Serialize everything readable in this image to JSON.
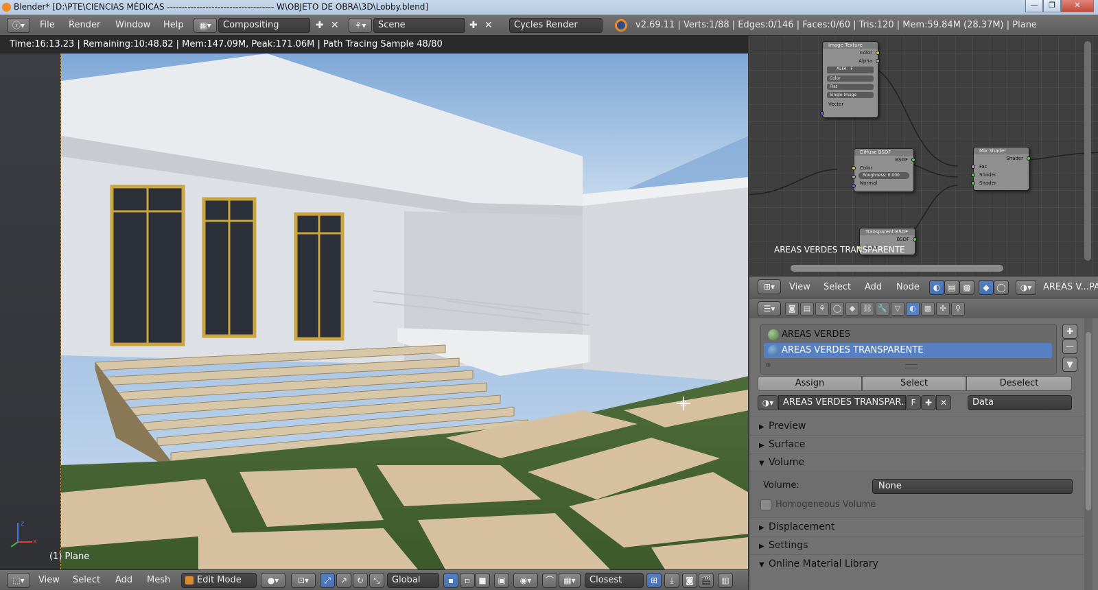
{
  "window": {
    "title": "Blender* [D:\\PTE\\CIENCIAS MÉDICAS ------------------------------------ W\\OBJETO DE OBRA\\3D\\Lobby.blend]",
    "min": "—",
    "max": "❐",
    "close": "✕"
  },
  "topbar": {
    "menus": [
      "File",
      "Render",
      "Window",
      "Help"
    ],
    "screen_layout": "Compositing",
    "scene": "Scene",
    "render_engine": "Cycles Render",
    "stats": "v2.69.11 | Verts:1/88 | Edges:0/146 | Faces:0/60 | Tris:120 | Mem:59.84M (28.37M) | Plane"
  },
  "viewport": {
    "render_info": "Time:16:13.23 | Remaining:10:48.82 | Mem:147.09M, Peak:171.06M | Path Tracing Sample 48/80",
    "object_label": "(1) Plane",
    "axis_x": "x",
    "axis_z": "z"
  },
  "viewport_header": {
    "menus": [
      "View",
      "Select",
      "Add",
      "Mesh"
    ],
    "mode": "Edit Mode",
    "orientation": "Global",
    "snap": "Closest"
  },
  "node_editor": {
    "nodes": {
      "image_texture": {
        "title": "Image Texture",
        "out1": "Color",
        "out2": "Alpha",
        "chip": "ALFA",
        "chip2": "F",
        "opt1": "Color",
        "opt2": "Flat",
        "opt3": "Single Image",
        "in1": "Vector"
      },
      "diffuse": {
        "title": "Diffuse BSDF",
        "out1": "BSDF",
        "in1": "Color",
        "roughness": "Roughness:  0.000",
        "in2": "Normal"
      },
      "mix": {
        "title": "Mix Shader",
        "out1": "Shader",
        "in1": "Fac",
        "in2": "Shader",
        "in3": "Shader"
      },
      "transparent": {
        "title": "Transparent BSDF",
        "out1": "BSDF",
        "in1": "Color"
      }
    },
    "material_label": "AREAS VERDES TRANSPARENTE"
  },
  "node_header": {
    "menus": [
      "View",
      "Select",
      "Add",
      "Node"
    ],
    "material": "AREAS V...PA"
  },
  "properties": {
    "slots": [
      "AREAS VERDES",
      "AREAS VERDES TRANSPARENTE"
    ],
    "selected_slot": 1,
    "assign": "Assign",
    "select": "Select",
    "deselect": "Deselect",
    "material_name": "AREAS VERDES TRANSPAR...",
    "fake_user": "F",
    "link": "Data",
    "panels": {
      "preview": "Preview",
      "surface": "Surface",
      "volume": "Volume",
      "volume_label": "Volume:",
      "volume_value": "None",
      "homogeneous": "Homogeneous Volume",
      "displacement": "Displacement",
      "settings": "Settings",
      "library": "Online Material Library"
    }
  },
  "colors": {
    "selected_slot": "#5680c2",
    "header": "#666666",
    "node_bg": "#3f3f3f"
  }
}
